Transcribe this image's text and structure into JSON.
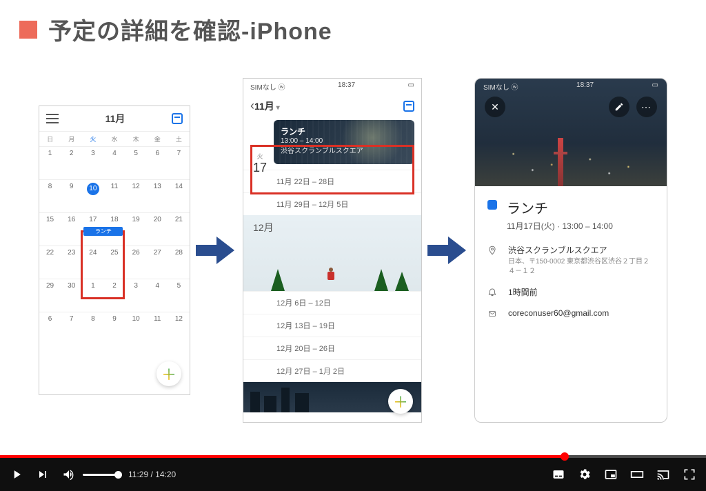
{
  "slide": {
    "title": "予定の詳細を確認-iPhone"
  },
  "phone1": {
    "month": "11月",
    "dow": [
      "日",
      "月",
      "火",
      "水",
      "木",
      "金",
      "土"
    ],
    "weeks": [
      [
        1,
        2,
        3,
        4,
        5,
        6,
        7
      ],
      [
        8,
        9,
        10,
        11,
        12,
        13,
        14
      ],
      [
        15,
        16,
        17,
        18,
        19,
        20,
        21
      ],
      [
        22,
        23,
        24,
        25,
        26,
        27,
        28
      ],
      [
        29,
        30,
        1,
        2,
        3,
        4,
        5
      ],
      [
        6,
        7,
        8,
        9,
        10,
        11,
        12
      ]
    ],
    "today": 10,
    "event_chip": "ランチ"
  },
  "phone2": {
    "status_left": "SIMなし ⓦ",
    "status_time": "18:37",
    "month": "11月",
    "day_dow": "火",
    "day_num": "17",
    "event": {
      "title": "ランチ",
      "time": "13:00 – 14:00",
      "place": "渋谷スクランブルスクエア"
    },
    "weeks": [
      "11月 22日 – 28日",
      "11月 29日 – 12月 5日"
    ],
    "dec_label": "12月",
    "dec_weeks": [
      "12月 6日 – 12日",
      "12月 13日 – 19日",
      "12月 20日 – 26日",
      "12月 27日 – 1月 2日"
    ]
  },
  "phone3": {
    "status_left": "SIMなし ⓦ",
    "status_time": "18:37",
    "title": "ランチ",
    "subtitle": "11月17日(火) · 13:00 – 14:00",
    "location": "渋谷スクランブルスクエア",
    "location_sub": "日本、〒150-0002 東京都渋谷区渋谷２丁目２４－１２",
    "reminder": "1時間前",
    "email": "coreconuser60@gmail.com"
  },
  "player": {
    "elapsed": "11:29",
    "total": "14:20",
    "fraction": 0.8
  }
}
